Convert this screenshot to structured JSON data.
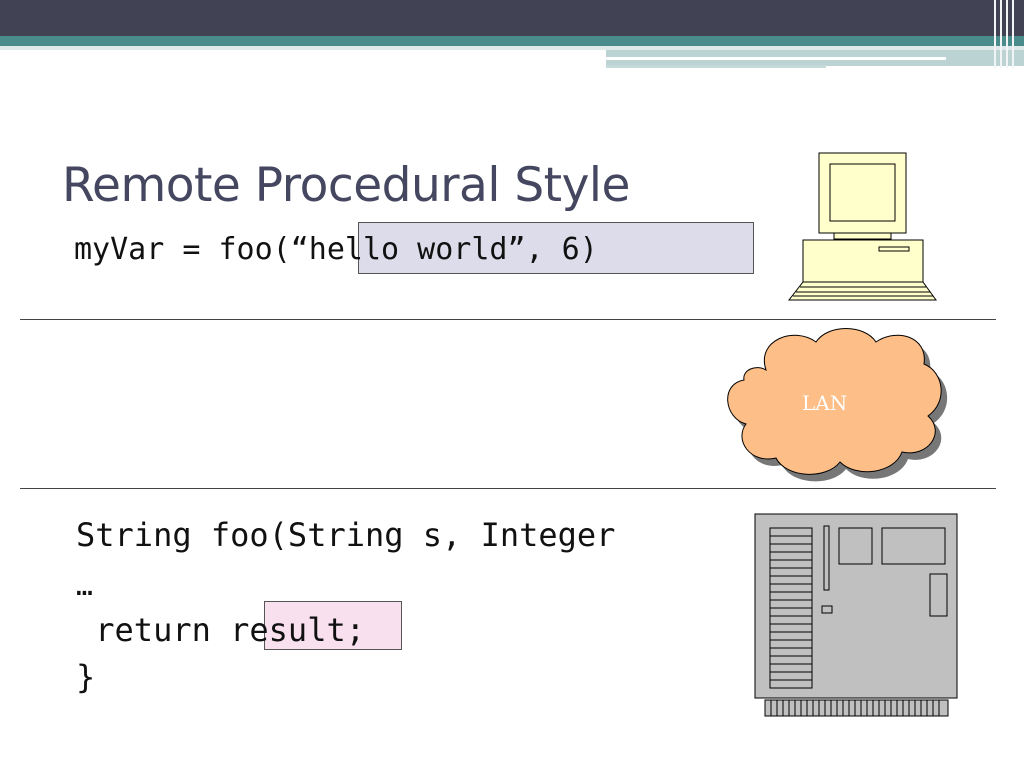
{
  "slide": {
    "title": "Remote Procedural Style"
  },
  "client": {
    "call": "myVar = foo(“hello world”, 6)"
  },
  "network": {
    "label": "LAN"
  },
  "server": {
    "signature": "String foo(String s, Integer",
    "ellipsis": "…",
    "return_stmt": " return result;",
    "closing_brace": "}"
  },
  "colors": {
    "header_dark": "#424255",
    "header_teal": "#4a8b8c",
    "title_text": "#44475f",
    "args_highlight": "#dcdcea",
    "result_highlight": "#f9e0ef",
    "cloud_fill": "#fdbf87",
    "computer_fill": "#ffffcc",
    "server_fill": "#c0c0c0"
  },
  "icons": [
    "desktop-computer-icon",
    "lan-cloud-icon",
    "server-tower-icon"
  ]
}
